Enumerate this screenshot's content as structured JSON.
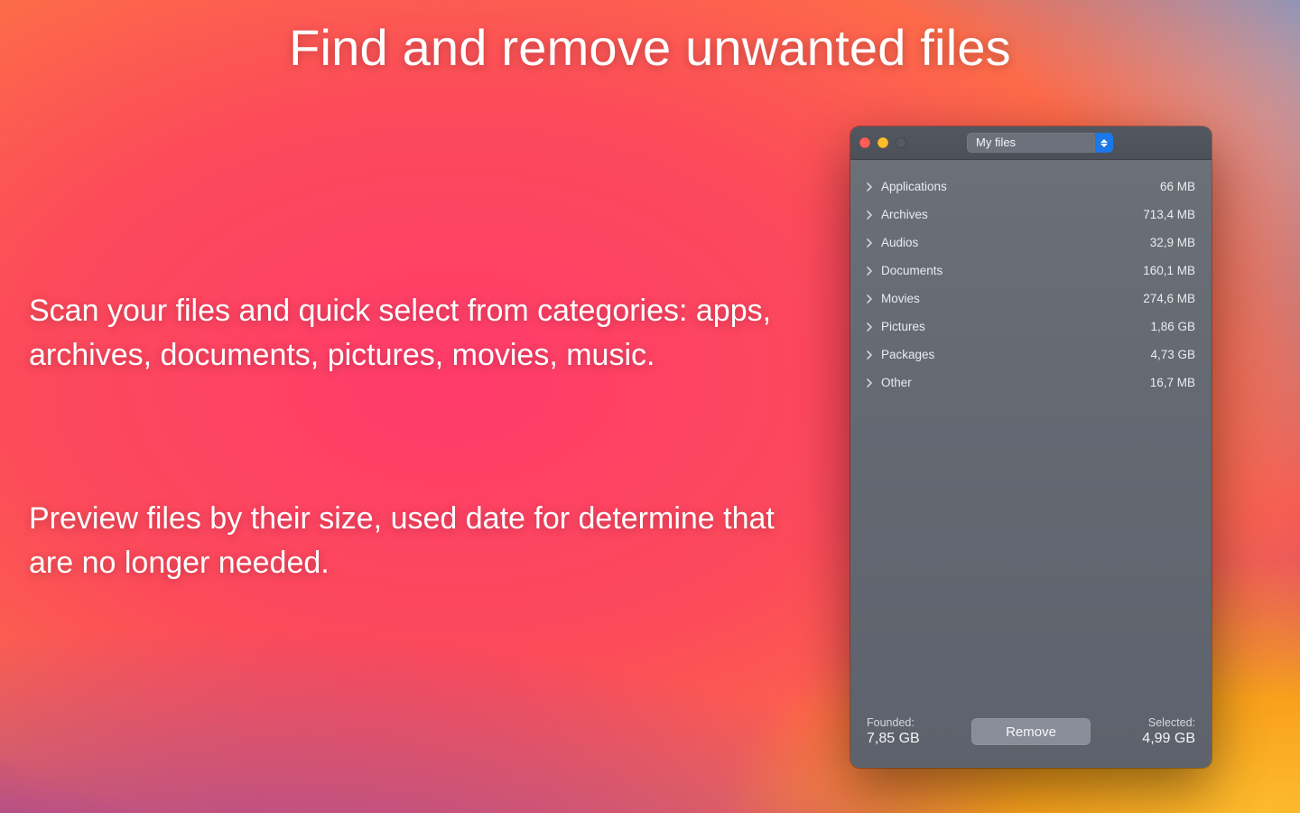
{
  "marketing": {
    "headline": "Find and remove unwanted files",
    "paragraph1": "Scan your files and quick select from categories: apps, archives, documents, pictures, movies, music.",
    "paragraph2": "Preview files by their size, used date for determine that are no longer needed."
  },
  "window": {
    "title_select": {
      "label": "My files"
    },
    "categories": [
      {
        "name": "Applications",
        "size": "66 MB"
      },
      {
        "name": "Archives",
        "size": "713,4 MB"
      },
      {
        "name": "Audios",
        "size": "32,9 MB"
      },
      {
        "name": "Documents",
        "size": "160,1 MB"
      },
      {
        "name": "Movies",
        "size": "274,6 MB"
      },
      {
        "name": "Pictures",
        "size": "1,86 GB"
      },
      {
        "name": "Packages",
        "size": "4,73 GB"
      },
      {
        "name": "Other",
        "size": "16,7 MB"
      }
    ],
    "footer": {
      "founded_label": "Founded:",
      "founded_value": "7,85 GB",
      "selected_label": "Selected:",
      "selected_value": "4,99 GB",
      "remove_label": "Remove"
    }
  }
}
